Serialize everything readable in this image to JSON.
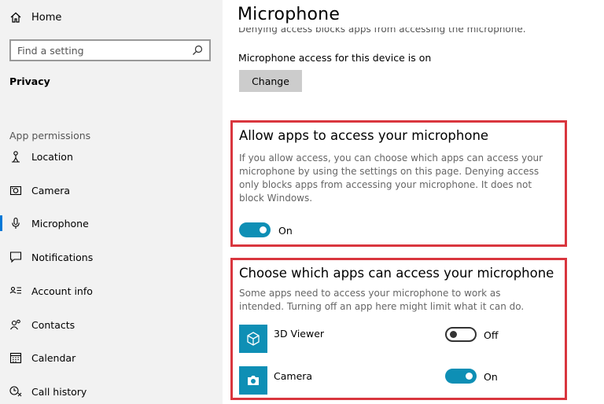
{
  "sidebar": {
    "home_label": "Home",
    "search_placeholder": "Find a setting",
    "privacy_label": "Privacy",
    "section_label": "App permissions",
    "items": [
      {
        "label": "Location",
        "icon": "location-icon"
      },
      {
        "label": "Camera",
        "icon": "camera-icon"
      },
      {
        "label": "Microphone",
        "icon": "microphone-icon",
        "active": true
      },
      {
        "label": "Notifications",
        "icon": "notifications-icon"
      },
      {
        "label": "Account info",
        "icon": "account-info-icon"
      },
      {
        "label": "Contacts",
        "icon": "contacts-icon"
      },
      {
        "label": "Calendar",
        "icon": "calendar-icon"
      },
      {
        "label": "Call history",
        "icon": "call-history-icon"
      }
    ]
  },
  "main": {
    "title": "Microphone",
    "cut_text": "Denying access blocks apps from accessing the microphone.",
    "device_status": "Microphone access for this device is on",
    "change_label": "Change",
    "allow_section": {
      "title": "Allow apps to access your microphone",
      "description": "If you allow access, you can choose which apps can access your microphone by using the settings on this page. Denying access only blocks apps from accessing your microphone. It does not block Windows.",
      "toggle_state": "On"
    },
    "choose_section": {
      "title": "Choose which apps can access your microphone",
      "description": "Some apps need to access your microphone to work as intended. Turning off an app here might limit what it can do.",
      "apps": [
        {
          "name": "3D Viewer",
          "state": "Off",
          "icon": "cube-icon"
        },
        {
          "name": "Camera",
          "state": "On",
          "icon": "camera-icon"
        }
      ]
    },
    "colors": {
      "accent": "#0e8fb5",
      "highlight_border": "#d9363e"
    }
  }
}
